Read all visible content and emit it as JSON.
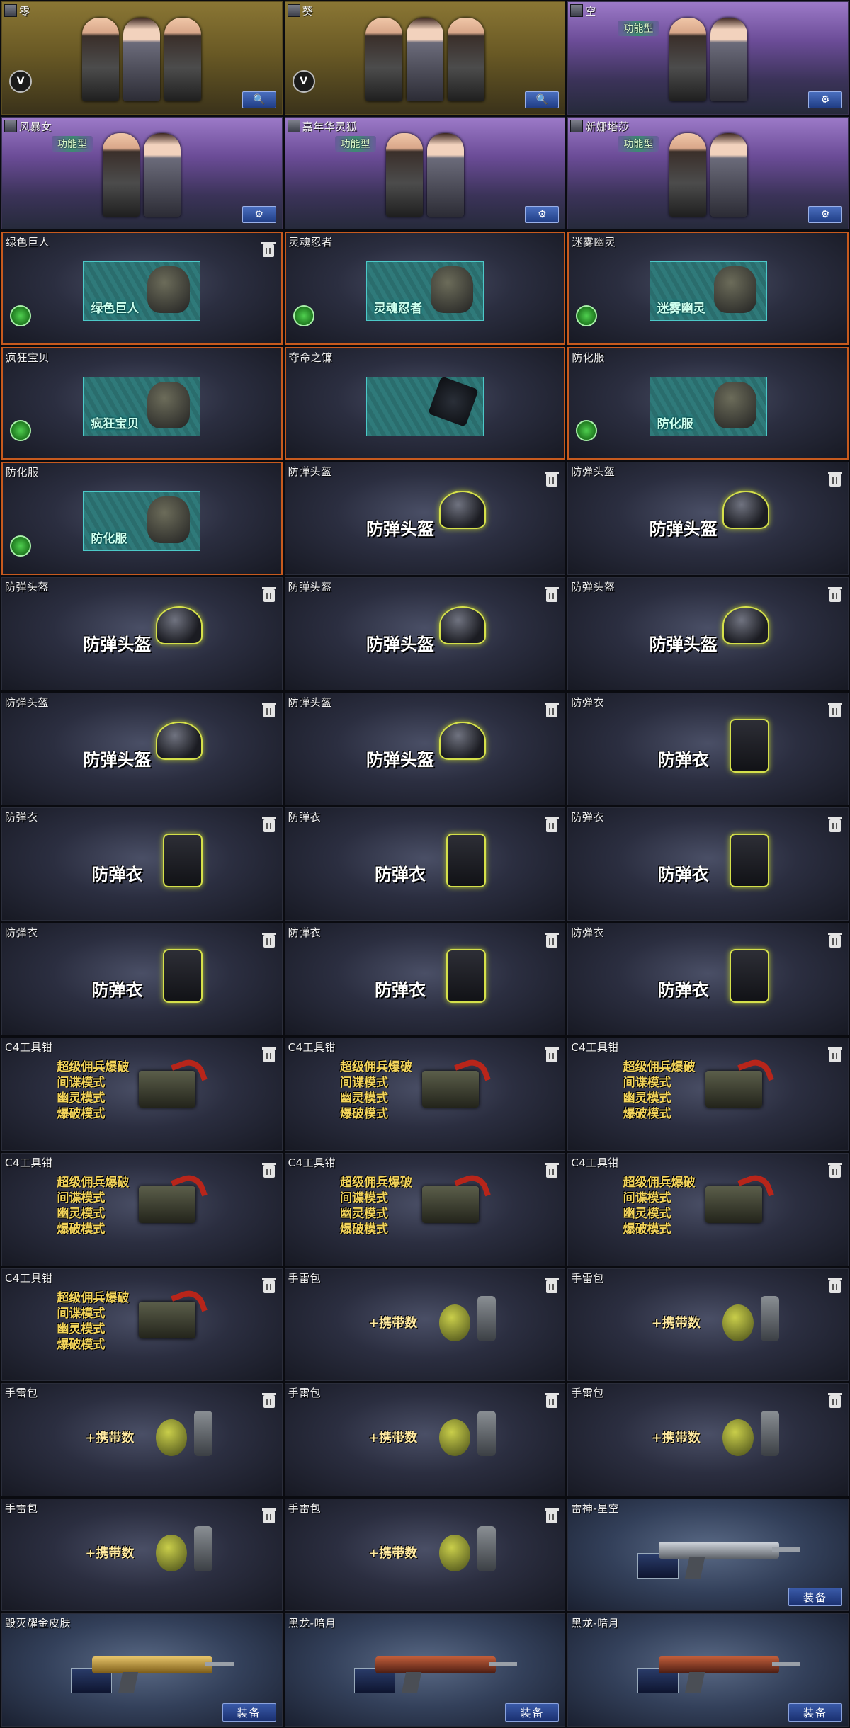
{
  "colors": {
    "accent_gold": "#8a7634",
    "accent_purple": "#6b4c97",
    "accent_orange": "#c75a1e",
    "button_blue": "#2a4ba0"
  },
  "cards": [
    {
      "kind": "character",
      "variant": "gold",
      "title": "零",
      "figures": 3,
      "v_icon": true,
      "v_label": "V",
      "action": "search",
      "action_icon": "search-icon",
      "action_symbol": "🔍"
    },
    {
      "kind": "character",
      "variant": "gold",
      "title": "葵",
      "figures": 3,
      "v_icon": true,
      "v_label": "V",
      "action": "search",
      "action_icon": "search-icon",
      "action_symbol": "🔍"
    },
    {
      "kind": "character",
      "variant": "purple",
      "title": "空",
      "figures": 2,
      "badge": "功能型",
      "action": "settings",
      "action_icon": "gear-icon",
      "action_symbol": "⚙"
    },
    {
      "kind": "character",
      "variant": "purple",
      "title": "风暴女",
      "figures": 2,
      "badge": "功能型",
      "action": "settings",
      "action_icon": "gear-icon",
      "action_symbol": "⚙"
    },
    {
      "kind": "character",
      "variant": "purple",
      "title": "嘉年华灵狐",
      "figures": 2,
      "badge": "功能型",
      "action": "settings",
      "action_icon": "gear-icon",
      "action_symbol": "⚙"
    },
    {
      "kind": "character",
      "variant": "purple",
      "title": "新娜塔莎",
      "figures": 2,
      "badge": "功能型",
      "action": "settings",
      "action_icon": "gear-icon",
      "action_symbol": "⚙"
    },
    {
      "kind": "zombie",
      "title": "绿色巨人",
      "art_label": "绿色巨人",
      "trash": true
    },
    {
      "kind": "zombie",
      "title": "灵魂忍者",
      "art_label": "灵魂忍者",
      "trash": false
    },
    {
      "kind": "zombie",
      "title": "迷雾幽灵",
      "art_label": "迷雾幽灵",
      "trash": false
    },
    {
      "kind": "zombie",
      "title": "疯狂宝贝",
      "art_label": "疯狂宝贝",
      "trash": false
    },
    {
      "kind": "zombie",
      "title": "夺命之镰",
      "art_label": "",
      "trash": false,
      "no_swap": true,
      "scythe": true
    },
    {
      "kind": "zombie",
      "title": "防化服",
      "art_label": "防化服",
      "trash": false
    },
    {
      "kind": "zombie",
      "title": "防化服",
      "art_label": "防化服",
      "trash": false
    },
    {
      "kind": "helmet",
      "title": "防弹头盔",
      "label": "防弹头盔"
    },
    {
      "kind": "helmet",
      "title": "防弹头盔",
      "label": "防弹头盔"
    },
    {
      "kind": "helmet",
      "title": "防弹头盔",
      "label": "防弹头盔"
    },
    {
      "kind": "helmet",
      "title": "防弹头盔",
      "label": "防弹头盔"
    },
    {
      "kind": "helmet",
      "title": "防弹头盔",
      "label": "防弹头盔"
    },
    {
      "kind": "helmet",
      "title": "防弹头盔",
      "label": "防弹头盔"
    },
    {
      "kind": "helmet",
      "title": "防弹头盔",
      "label": "防弹头盔"
    },
    {
      "kind": "vest",
      "title": "防弹衣",
      "label": "防弹衣"
    },
    {
      "kind": "vest",
      "title": "防弹衣",
      "label": "防弹衣"
    },
    {
      "kind": "vest",
      "title": "防弹衣",
      "label": "防弹衣"
    },
    {
      "kind": "vest",
      "title": "防弹衣",
      "label": "防弹衣"
    },
    {
      "kind": "vest",
      "title": "防弹衣",
      "label": "防弹衣"
    },
    {
      "kind": "vest",
      "title": "防弹衣",
      "label": "防弹衣"
    },
    {
      "kind": "vest",
      "title": "防弹衣",
      "label": "防弹衣"
    },
    {
      "kind": "c4",
      "title": "C4工具钳",
      "lines": [
        "超级佣兵爆破",
        "间谍模式",
        "幽灵模式",
        "爆破模式"
      ]
    },
    {
      "kind": "c4",
      "title": "C4工具钳",
      "lines": [
        "超级佣兵爆破",
        "间谍模式",
        "幽灵模式",
        "爆破模式"
      ]
    },
    {
      "kind": "c4",
      "title": "C4工具钳",
      "lines": [
        "超级佣兵爆破",
        "间谍模式",
        "幽灵模式",
        "爆破模式"
      ]
    },
    {
      "kind": "c4",
      "title": "C4工具钳",
      "lines": [
        "超级佣兵爆破",
        "间谍模式",
        "幽灵模式",
        "爆破模式"
      ]
    },
    {
      "kind": "c4",
      "title": "C4工具钳",
      "lines": [
        "超级佣兵爆破",
        "间谍模式",
        "幽灵模式",
        "爆破模式"
      ]
    },
    {
      "kind": "c4",
      "title": "C4工具钳",
      "lines": [
        "超级佣兵爆破",
        "间谍模式",
        "幽灵模式",
        "爆破模式"
      ]
    },
    {
      "kind": "c4",
      "title": "C4工具钳",
      "lines": [
        "超级佣兵爆破",
        "间谍模式",
        "幽灵模式",
        "爆破模式"
      ]
    },
    {
      "kind": "grenade",
      "title": "手雷包",
      "label": "+携带数"
    },
    {
      "kind": "grenade",
      "title": "手雷包",
      "label": "+携带数"
    },
    {
      "kind": "grenade",
      "title": "手雷包",
      "label": "+携带数"
    },
    {
      "kind": "grenade",
      "title": "手雷包",
      "label": "+携带数"
    },
    {
      "kind": "grenade",
      "title": "手雷包",
      "label": "+携带数"
    },
    {
      "kind": "grenade",
      "title": "手雷包",
      "label": "+携带数"
    },
    {
      "kind": "grenade",
      "title": "手雷包",
      "label": "+携带数"
    },
    {
      "kind": "weapon",
      "title": "雷神-星空",
      "equip": "装备",
      "gun": "silver"
    },
    {
      "kind": "weapon",
      "title": "毁灭耀金皮肤",
      "equip": "装备",
      "gun": "gold"
    },
    {
      "kind": "weapon",
      "title": "黑龙-暗月",
      "equip": "装备",
      "gun": "red"
    },
    {
      "kind": "weapon",
      "title": "黑龙-暗月",
      "equip": "装备",
      "gun": "red"
    }
  ]
}
